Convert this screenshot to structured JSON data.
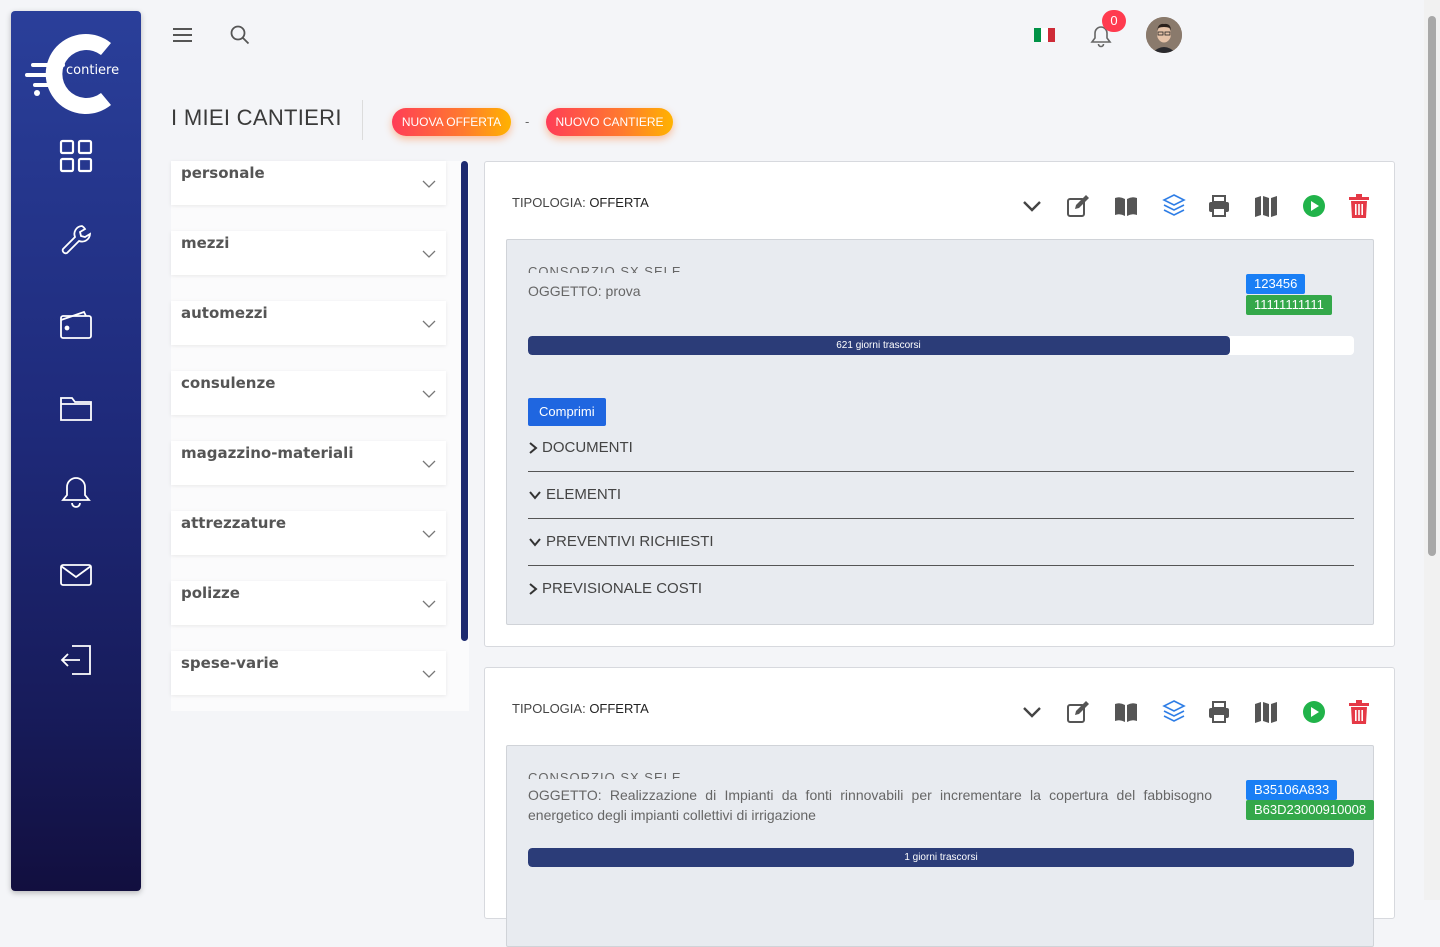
{
  "app": {
    "logo_text": "contiere"
  },
  "sidebar": {
    "items": [
      {
        "name": "dashboard"
      },
      {
        "name": "tools"
      },
      {
        "name": "wallet"
      },
      {
        "name": "folder"
      },
      {
        "name": "bell"
      },
      {
        "name": "mail"
      },
      {
        "name": "logout"
      }
    ]
  },
  "topbar": {
    "notification_count": "0",
    "flag_colors": [
      "#009246",
      "#ffffff",
      "#ce2b37"
    ]
  },
  "header": {
    "title": "I MIEI CANTIERI",
    "new_offer": "NUOVA OFFERTA",
    "separator": "-",
    "new_site": "NUOVO CANTIERE"
  },
  "filters": [
    "personale",
    "mezzi",
    "automezzi",
    "consulenze",
    "magazzino-materiali",
    "attrezzature",
    "polizze",
    "spese-varie"
  ],
  "cards": [
    {
      "type_label": "TIPOLOGIA:",
      "type_value": "OFFERTA",
      "consorzio": "CONSORZIO SX SELE",
      "oggetto": "OGGETTO: prova",
      "tag1": "123456",
      "tag2": "11111111111",
      "progress_text": "621 giorni trascorsi",
      "progress_pct": 85,
      "comprimi": "Comprimi",
      "sections": [
        {
          "label": "DOCUMENTI",
          "state": "collapsed"
        },
        {
          "label": "ELEMENTI",
          "state": "expanded"
        },
        {
          "label": "PREVENTIVI RICHIESTI",
          "state": "expanded"
        },
        {
          "label": "PREVISIONALE COSTI",
          "state": "collapsed"
        }
      ]
    },
    {
      "type_label": "TIPOLOGIA:",
      "type_value": "OFFERTA",
      "consorzio": "CONSORZIO SX SELE",
      "oggetto": "OGGETTO: Realizzazione di Impianti da fonti rinnovabili per incrementare la copertura del fabbisogno energetico degli impianti collettivi di irrigazione",
      "tag1": "B35106A833",
      "tag2": "B63D23000910008",
      "progress_text": "1 giorni trascorsi",
      "progress_pct": 100
    }
  ],
  "colors": {
    "accent_blue": "#1f66e0",
    "tag_blue": "#1a7ff5",
    "tag_green": "#34a84a",
    "progress": "#2b3c78",
    "delete": "#e53946",
    "play": "#21b34a",
    "layers": "#2f7ee6"
  }
}
